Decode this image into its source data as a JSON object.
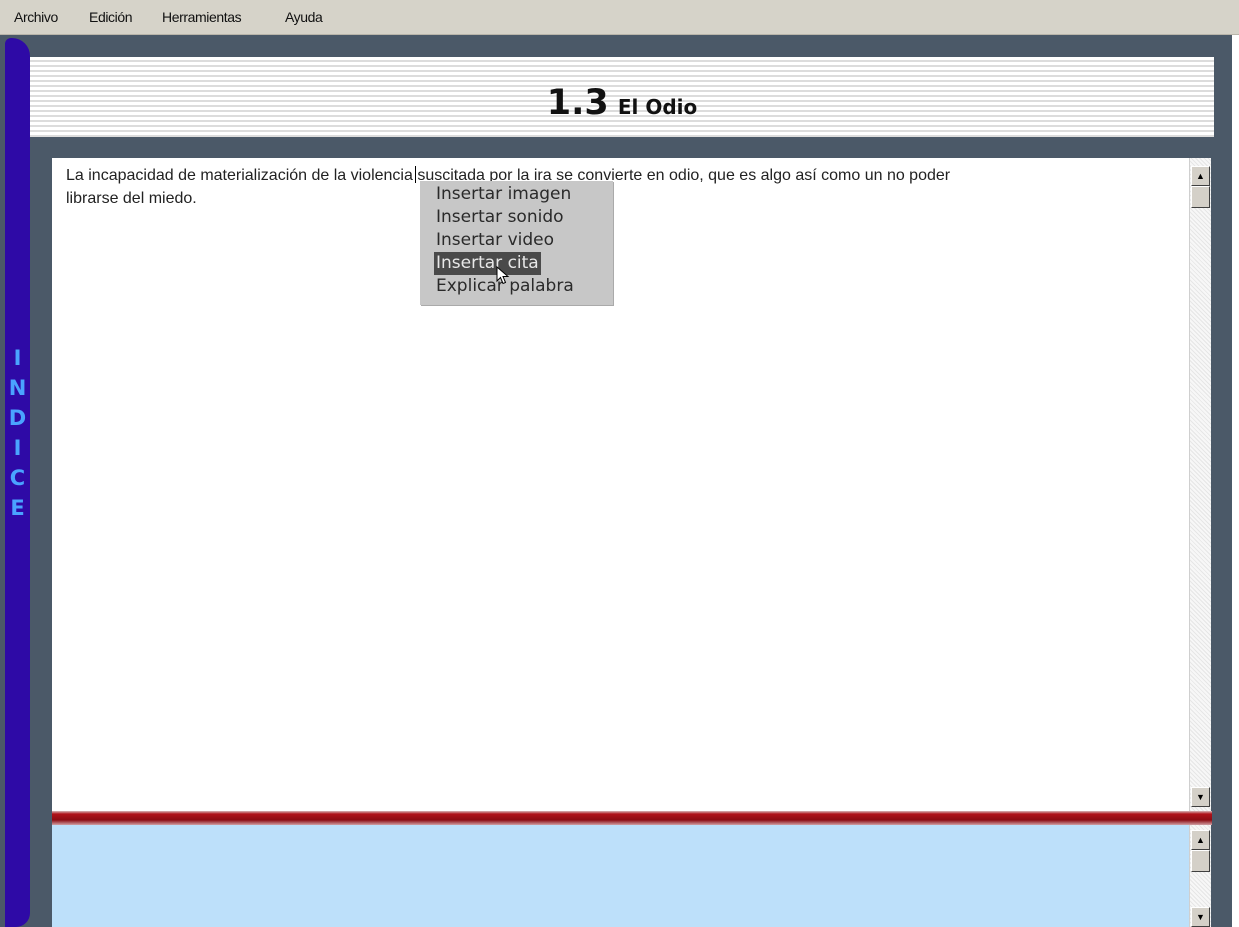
{
  "menubar": {
    "items": [
      "Archivo",
      "Edición",
      "Herramientas",
      "Ayuda"
    ]
  },
  "sidebar": {
    "index_label": [
      "I",
      "N",
      "D",
      "I",
      "C",
      "E"
    ]
  },
  "section": {
    "number": "1.3",
    "name": "El Odio"
  },
  "content": {
    "line1": "La incapacidad de materialización de la violencia suscitada por la ira se convierte en odio, que es algo así como un no poder",
    "line2": "librarse del miedo."
  },
  "context_menu": {
    "items": [
      {
        "label": "Insertar imagen",
        "selected": false
      },
      {
        "label": "Insertar sonido",
        "selected": false
      },
      {
        "label": "Insertar video",
        "selected": false
      },
      {
        "label": "Insertar cita",
        "selected": true
      },
      {
        "label": "Explicar palabra",
        "selected": false
      }
    ]
  },
  "colors": {
    "sidebar": "#2e0aa6",
    "index_text": "#4aa3ff",
    "frame": "#4b5968",
    "divider": "#b0121a",
    "notes_background": "#bde0fa",
    "menu_background": "#c7c7c7",
    "menu_highlight": "#4a4a4a"
  },
  "icons": {
    "scroll_up": "arrow-up-icon",
    "scroll_down": "arrow-down-icon",
    "pointer": "mouse-pointer-icon"
  }
}
